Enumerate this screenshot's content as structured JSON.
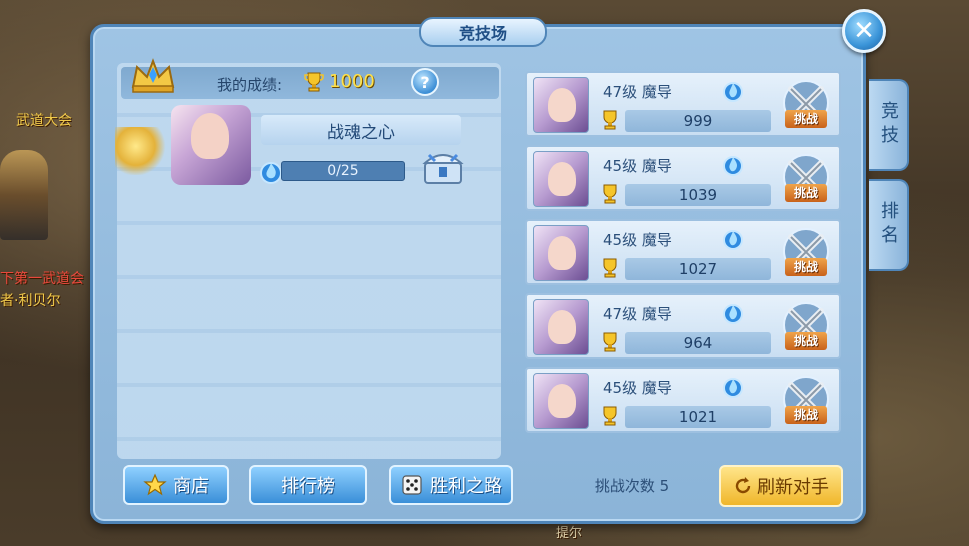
{
  "background": {
    "left_texts": [
      "武道大会",
      "下第一武道会",
      "者·利贝尔"
    ],
    "bottom_text": "提尔"
  },
  "panel": {
    "title": "竞技场",
    "close_label": "✕"
  },
  "score": {
    "label": "我的成绩:",
    "value": "1000",
    "help_label": "?"
  },
  "soul": {
    "name": "战魂之心",
    "progress": "0/25"
  },
  "opponents": [
    {
      "level": "47级",
      "class": "魔导",
      "score": "999",
      "challenge": "挑战"
    },
    {
      "level": "45级",
      "class": "魔导",
      "score": "1039",
      "challenge": "挑战"
    },
    {
      "level": "45级",
      "class": "魔导",
      "score": "1027",
      "challenge": "挑战"
    },
    {
      "level": "47级",
      "class": "魔导",
      "score": "964",
      "challenge": "挑战"
    },
    {
      "level": "45级",
      "class": "魔导",
      "score": "1021",
      "challenge": "挑战"
    }
  ],
  "side_tabs": [
    "竞技",
    "排名"
  ],
  "bottom": {
    "shop": "商店",
    "ranking": "排行榜",
    "victory_road": "胜利之路",
    "attempts": "挑战次数 5",
    "refresh": "刷新对手"
  }
}
